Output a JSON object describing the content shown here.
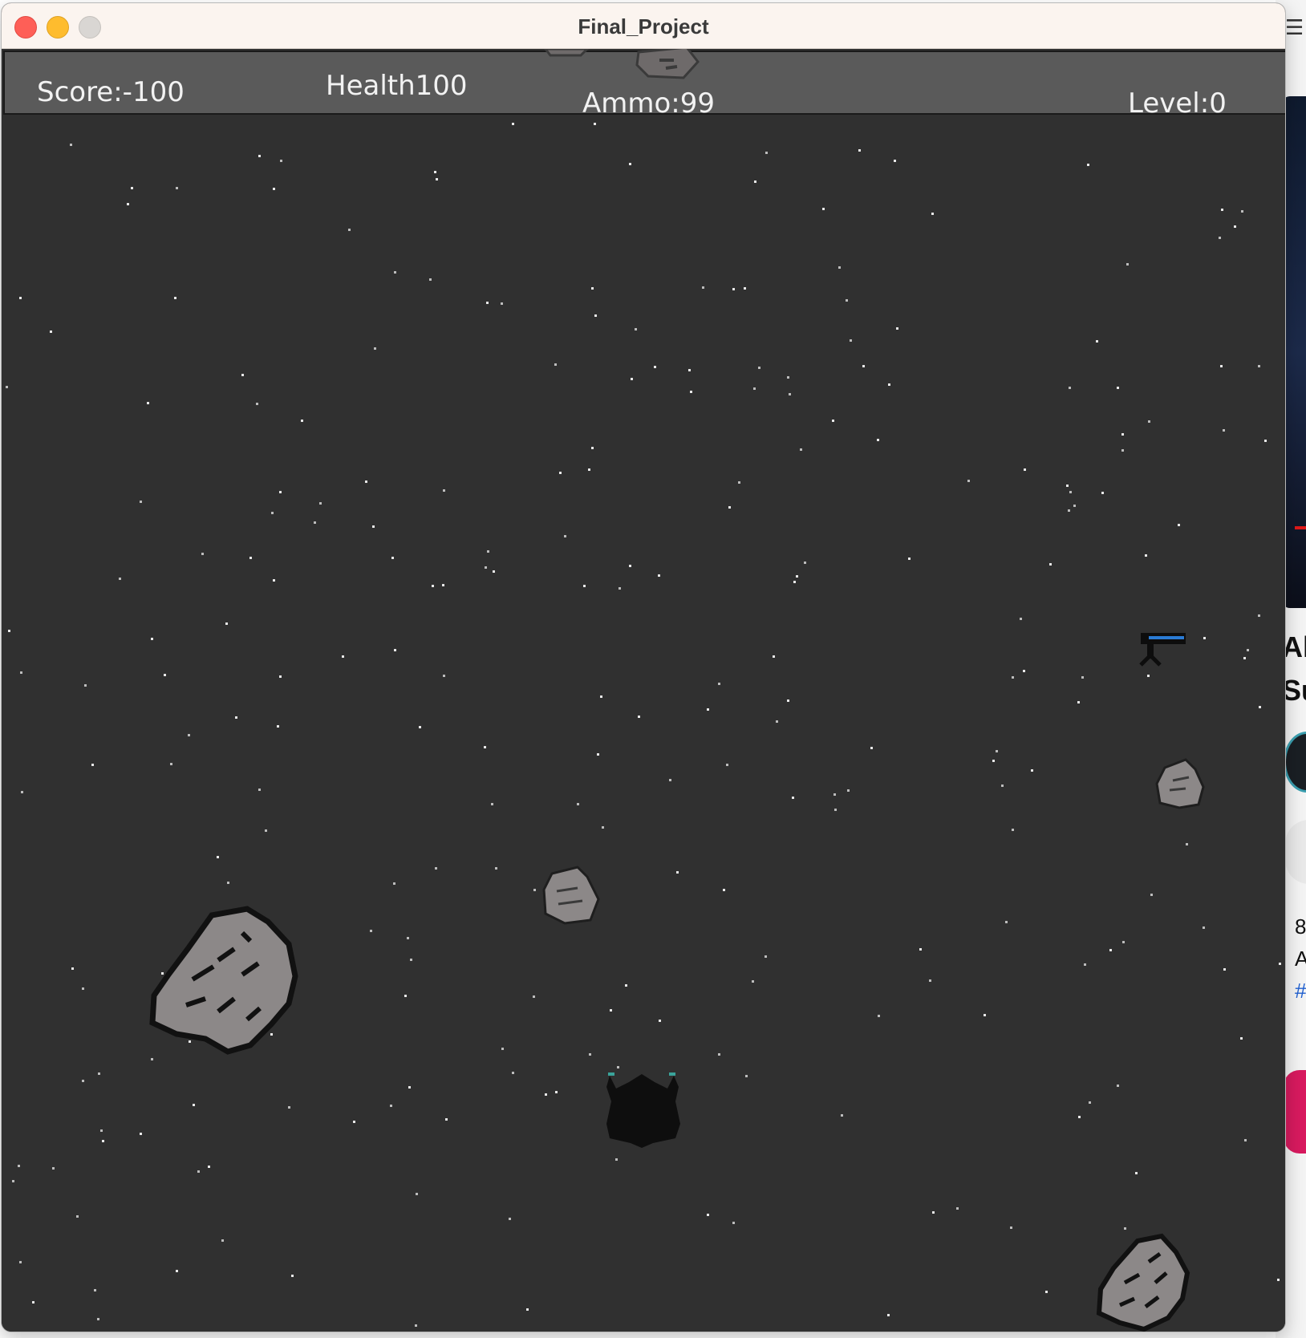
{
  "window": {
    "title": "Final_Project"
  },
  "hud": {
    "score_label": "Score:-100",
    "health_label": "Health100",
    "ammo_label": "Ammo:99",
    "level_label": "Level:0"
  },
  "game": {
    "score": -100,
    "health": 100,
    "ammo": 99,
    "level": 0,
    "colors": {
      "background": "#303030",
      "hud_bar": "#5a5a5a",
      "hud_text": "#f2f2f2",
      "asteroid": "#8c8888",
      "asteroid_outline": "#111111",
      "player_ship": "#0e0e0e",
      "ship_thrusters": "#3aa39a",
      "enemy_beam": "#2a7bd4"
    },
    "sprites": [
      "large-asteroid-icon",
      "small-asteroid-icon",
      "player-ship-icon",
      "enemy-turret-icon"
    ]
  },
  "background_app": {
    "text_fragments": [
      "Al",
      "Su",
      "8",
      "A",
      "#"
    ]
  }
}
